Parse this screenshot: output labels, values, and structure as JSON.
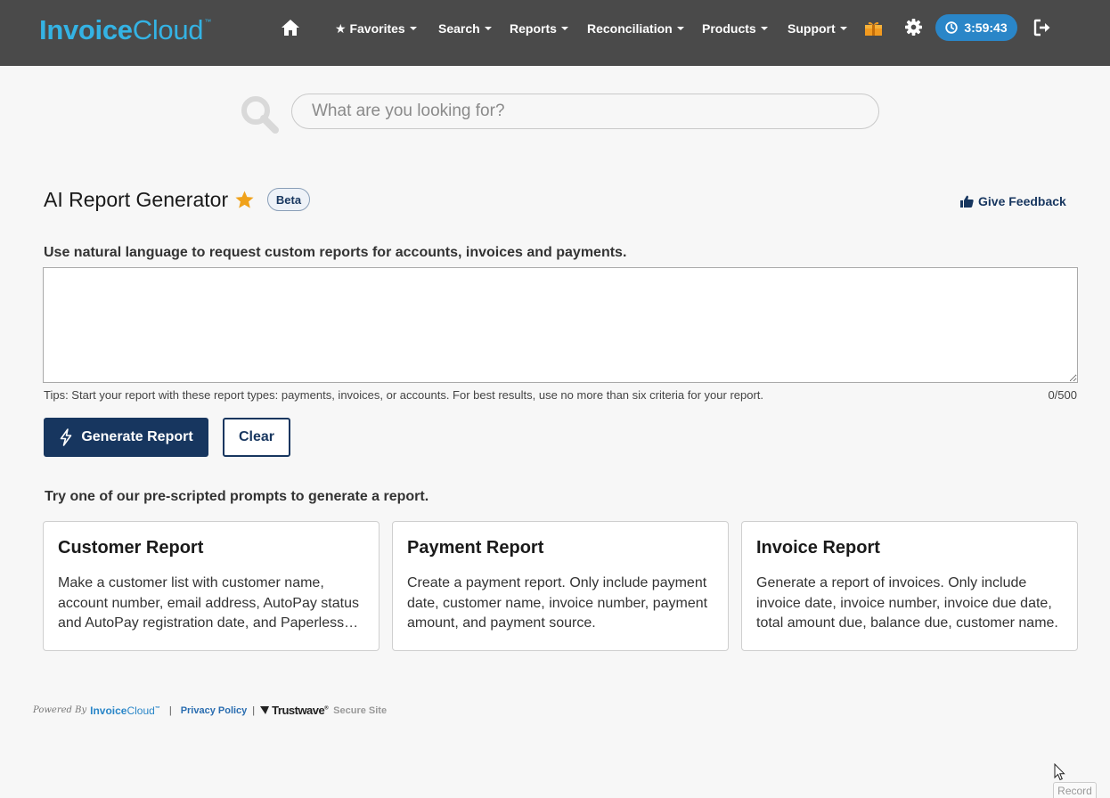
{
  "brand": {
    "logo_bold": "Invoice",
    "logo_light": "Cloud",
    "logo_mark": "™"
  },
  "nav": {
    "items": [
      {
        "label": "★ Favorites"
      },
      {
        "label": "Search"
      },
      {
        "label": "Reports"
      },
      {
        "label": "Reconciliation"
      },
      {
        "label": "Products"
      },
      {
        "label": "Support"
      }
    ],
    "timer": "3:59:43",
    "icons": [
      "home-icon",
      "gift-icon",
      "gear-icon",
      "clock-icon",
      "logout-icon"
    ]
  },
  "search": {
    "placeholder": "What are you looking for?"
  },
  "page": {
    "title": "AI Report Generator",
    "badge": "Beta",
    "feedback_label": "Give Feedback",
    "instruction": "Use natural language to request custom reports for accounts, invoices and payments.",
    "prompt_value": "",
    "tips": "Tips: Start your report with these report types: payments, invoices, or accounts. For best results, use no more than six criteria for your report.",
    "char_count": "0/500",
    "generate_label": "Generate Report",
    "clear_label": "Clear",
    "prescripted_heading": "Try one of our pre-scripted prompts to generate a report."
  },
  "cards": [
    {
      "title": "Customer Report",
      "text": "Make a customer list with customer name, account number, email address, AutoPay status and AutoPay registration date, and Paperless status."
    },
    {
      "title": "Payment Report",
      "text": "Create a payment report. Only include payment date, customer name, invoice number, payment amount, and payment source."
    },
    {
      "title": "Invoice Report",
      "text": "Generate a report of invoices. Only include invoice date, invoice number, invoice due date, total amount due, balance due, customer name."
    }
  ],
  "footer": {
    "powered_by": "Powered By",
    "ic_bold": "Invoice",
    "ic_light": "Cloud",
    "ic_mark": "™",
    "privacy": "Privacy Policy",
    "trustwave": "Trustwave",
    "trustwave_mark": "®",
    "secure": "Secure Site"
  },
  "record_label": "Record",
  "colors": {
    "nav_bg": "#4a4a4a",
    "brand_blue": "#34b3e4",
    "primary": "#17365f",
    "timer_bg": "#2a86c8",
    "star": "#f0a21b"
  }
}
